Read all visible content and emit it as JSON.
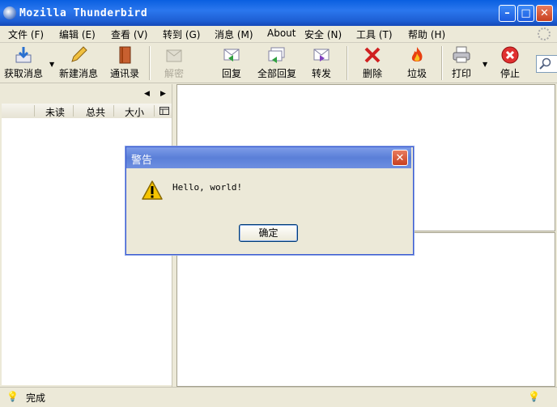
{
  "window": {
    "title": "Mozilla Thunderbird",
    "minimize": "–",
    "maximize": "□",
    "close": "✕"
  },
  "menu": [
    {
      "label": "文件 (F)"
    },
    {
      "label": "编辑 (E)"
    },
    {
      "label": "查看 (V)"
    },
    {
      "label": "转到 (G)"
    },
    {
      "label": "消息 (M)"
    },
    {
      "label": "About"
    },
    {
      "label": "安全 (N)"
    },
    {
      "label": "工具 (T)"
    },
    {
      "label": "帮助 (H)"
    }
  ],
  "toolbar": {
    "get_mail": "获取消息",
    "new_message": "新建消息",
    "address_book": "通讯录",
    "decrypt": "解密",
    "reply": "回复",
    "reply_all": "全部回复",
    "forward": "转发",
    "delete": "删除",
    "junk": "垃圾",
    "print": "打印",
    "stop": "停止"
  },
  "folder_pane": {
    "columns": {
      "unread": "未读",
      "total": "总共",
      "size": "大小"
    }
  },
  "status": {
    "text": "完成"
  },
  "dialog": {
    "title": "警告",
    "message": "Hello, world!",
    "ok": "确定",
    "close": "✕"
  },
  "colors": {
    "title_blue": "#0a5fe0",
    "dialog_title": "#6e8fe0",
    "close_red": "#c8401f",
    "warn_yellow": "#f5c400"
  }
}
